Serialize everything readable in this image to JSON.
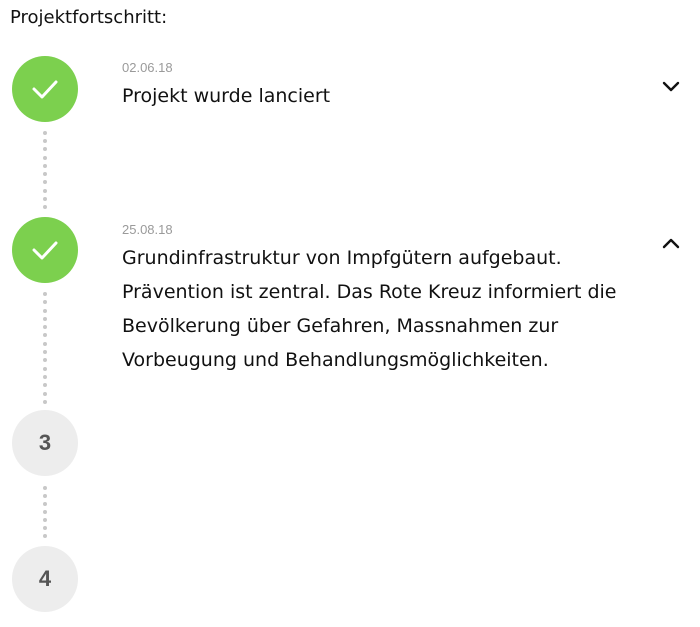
{
  "heading": "Projektfortschritt:",
  "colors": {
    "done": "#7cd04e",
    "todo": "#ededed",
    "date": "#9a9a9a",
    "dots": "#c8c8c8"
  },
  "steps": [
    {
      "status": "done",
      "date": "02.06.18",
      "title": "Projekt wurde lanciert",
      "expanded": false,
      "icon": "checkmark-icon",
      "toggle_icon": "chevron-down-icon"
    },
    {
      "status": "done",
      "date": "25.08.18",
      "title": "Grundinfrastruktur von Impfgütern aufgebaut.",
      "description": "Prävention ist zentral. Das Rote Kreuz informiert die Bevölkerung über Gefahren, Massnahmen zur Vorbeugung und Behandlungsmöglichkeiten.",
      "expanded": true,
      "icon": "checkmark-icon",
      "toggle_icon": "chevron-up-icon"
    },
    {
      "status": "pending",
      "number": "3"
    },
    {
      "status": "pending",
      "number": "4"
    }
  ]
}
